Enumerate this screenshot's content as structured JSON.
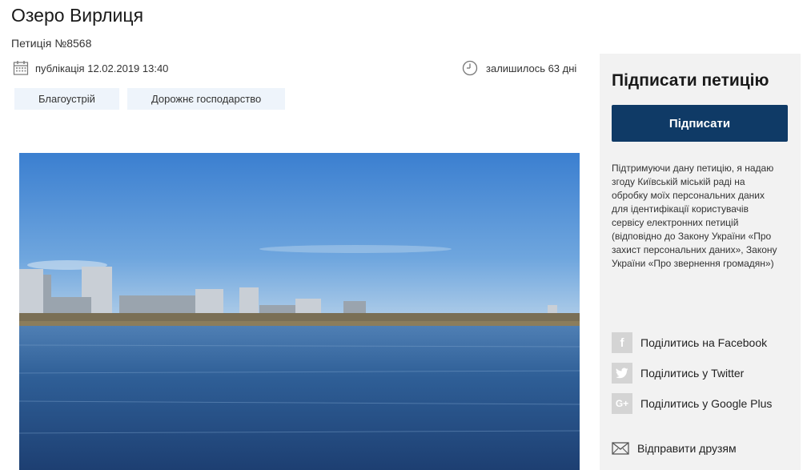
{
  "petition": {
    "title": "Озеро Вирлиця",
    "number": "Петиція №8568",
    "published": "публікація 12.02.2019 13:40",
    "remaining": "залишилось 63 дні",
    "tags": [
      "Благоустрій",
      "Дорожнє господарство"
    ]
  },
  "sidebar": {
    "title": "Підписати петицію",
    "sign_label": "Підписати",
    "consent_text": "Підтримуючи дану петицію, я надаю згоду Київській міській раді на обробку моїх персональних даних для ідентифікації користувачів сервісу електронних петицій (відповідно до Закону України «Про захист персональних даних», Закону України «Про звернення громадян»)",
    "share": {
      "facebook": "Поділитись на Facebook",
      "twitter": "Поділитись у Twitter",
      "google": "Поділитись у Google Plus",
      "email": "Відправити друзям"
    }
  },
  "icons": {
    "calendar": "calendar-icon",
    "clock": "clock-icon",
    "facebook": "facebook-icon",
    "twitter": "twitter-icon",
    "google": "google-plus-icon",
    "email": "envelope-icon"
  },
  "colors": {
    "accent": "#0f3a66",
    "tag_bg": "#eef4fb",
    "panel_bg": "#f2f2f2",
    "share_icon_bg": "#d4d4d4"
  }
}
